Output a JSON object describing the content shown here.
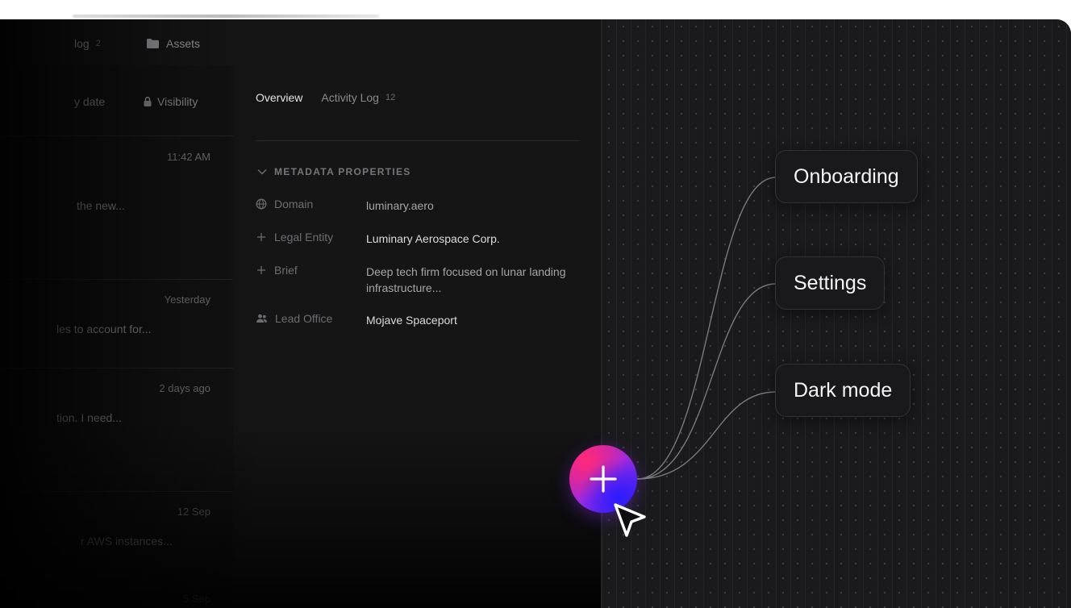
{
  "topbar": {
    "tab_left_label": "log",
    "tab_left_count": "2",
    "assets_label": "Assets"
  },
  "list": {
    "headers": {
      "date_label": "y date",
      "visibility_label": "Visibility"
    },
    "items": [
      {
        "time": "11:42 AM",
        "snippet": "the new..."
      },
      {
        "time": "Yesterday",
        "snippet": "les to account for..."
      },
      {
        "time": "2 days ago",
        "snippet": "tion. I need..."
      },
      {
        "time": "12 Sep",
        "snippet": "r AWS instances..."
      },
      {
        "time": "5 Sep",
        "snippet": ""
      }
    ]
  },
  "detail": {
    "tabs": [
      {
        "label": "Overview",
        "count": ""
      },
      {
        "label": "Activity Log",
        "count": "12"
      }
    ],
    "section_title": "METADATA PROPERTIES",
    "properties": [
      {
        "key": "Domain",
        "value": "luminary.aero",
        "icon": "globe-icon"
      },
      {
        "key": "Legal Entity",
        "value": "Luminary Aerospace Corp.",
        "icon": "plus-icon"
      },
      {
        "key": "Brief",
        "value": "Deep tech firm focused on lunar landing infrastructure...",
        "icon": "plus-icon"
      },
      {
        "key": "Lead Office",
        "value": "Mojave Spaceport",
        "icon": "users-icon"
      }
    ]
  },
  "canvas": {
    "nodes": [
      {
        "label": "Onboarding"
      },
      {
        "label": "Settings"
      },
      {
        "label": "Dark mode"
      }
    ],
    "add_button_icon": "plus-icon",
    "cursor_icon": "pointer-cursor-icon"
  },
  "colors": {
    "frame_bg": "#111112",
    "canvas_bg": "#1a1a1c",
    "pill_bg": "#19191b",
    "gradient_pink": "#e0208a",
    "gradient_purple": "#a22adf",
    "gradient_blue": "#3a22f0"
  }
}
